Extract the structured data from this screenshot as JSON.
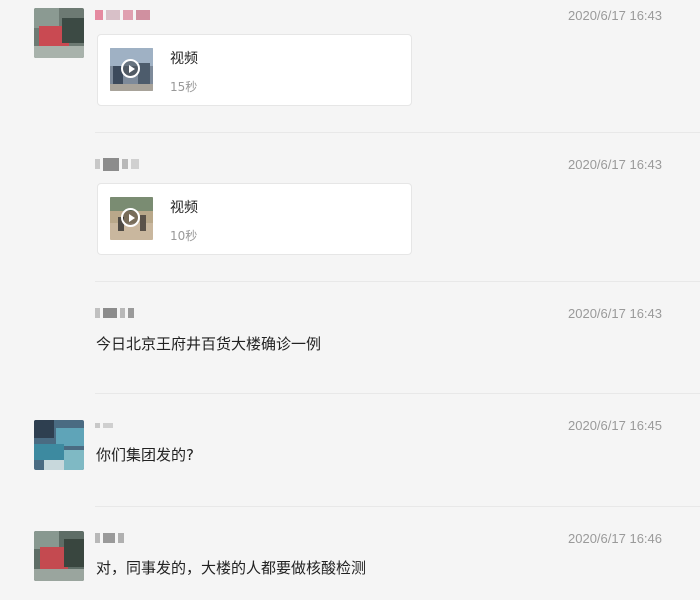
{
  "messages": [
    {
      "time": "2020/6/17 16:43",
      "video": {
        "title": "视频",
        "duration": "15秒"
      }
    },
    {
      "time": "2020/6/17 16:43",
      "video": {
        "title": "视频",
        "duration": "10秒"
      }
    },
    {
      "time": "2020/6/17 16:43",
      "text": "今日北京王府井百货大楼确诊一例"
    },
    {
      "time": "2020/6/17 16:45",
      "text": "你们集团发的?"
    },
    {
      "time": "2020/6/17 16:46",
      "text": "对，同事发的，大楼的人都要做核酸检测"
    }
  ],
  "icons": {
    "play": "play-icon"
  },
  "colors": {
    "background": "#f5f5f5",
    "card": "#ffffff",
    "timestamp": "#9a9a9a",
    "secondary_text": "#999999"
  }
}
